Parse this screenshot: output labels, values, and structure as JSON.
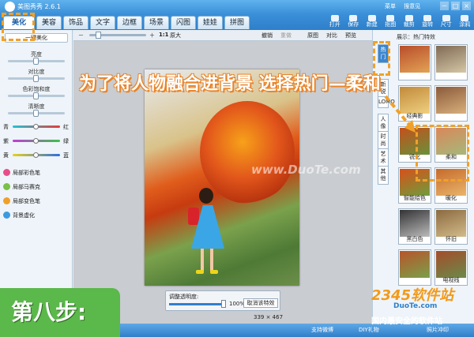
{
  "app": {
    "title": "美图秀秀 2.6.1",
    "window_links": [
      "菜单",
      "搜意见"
    ],
    "controls": [
      "－",
      "□",
      "×"
    ]
  },
  "tabs": [
    {
      "label": "美化",
      "active": true
    },
    {
      "label": "美容",
      "active": false
    },
    {
      "label": "饰品",
      "active": false
    },
    {
      "label": "文字",
      "active": false
    },
    {
      "label": "边框",
      "active": false
    },
    {
      "label": "场景",
      "active": false
    },
    {
      "label": "闪图",
      "active": false
    },
    {
      "label": "娃娃",
      "active": false
    },
    {
      "label": "拼图",
      "active": false
    }
  ],
  "toolbar": [
    "打开",
    "保存",
    "保存",
    "新建",
    "抠图",
    "裁剪",
    "旋转",
    "尺寸",
    "涂鸦",
    "撤销"
  ],
  "left_panel": {
    "one_click": "一键美化",
    "sliders": [
      {
        "label": "亮度",
        "value": 0.5
      },
      {
        "label": "对比度",
        "value": 0.5
      },
      {
        "label": "色彩饱和度",
        "value": 0.5
      },
      {
        "label": "清晰度",
        "value": 0.5
      }
    ],
    "color_sliders": [
      {
        "left": "青",
        "right": "红",
        "value": 0.5
      },
      {
        "left": "紫",
        "right": "绿",
        "value": 0.5
      },
      {
        "left": "黄",
        "right": "蓝",
        "value": 0.5
      }
    ],
    "brushes": [
      "局部彩色笔",
      "局部马赛克",
      "局部变色笔",
      "背景虚化"
    ]
  },
  "canvas_bar": {
    "zoom_ratio": "1:1",
    "zoom_original": "原大",
    "undo": "撤销",
    "redo": "重做",
    "original": "原图",
    "compare": "对比",
    "preview": "预览"
  },
  "photo": {
    "watermark": "www.DuoTe.com"
  },
  "opacity_panel": {
    "label": "调整透明度:",
    "value": "100%",
    "cancel": "取消该特效"
  },
  "image_dims": "339 × 467",
  "right_panel": {
    "header": "展示：热门特效",
    "vtabs": [
      "热门",
      "新锐",
      "LOMO",
      "人像",
      "时尚",
      "艺术",
      "其他"
    ],
    "thumbs": [
      {
        "label": "",
        "colors": [
          "#b84d2c",
          "#e3a354"
        ]
      },
      {
        "label": "",
        "colors": [
          "#7f6a55",
          "#d5c7a5"
        ]
      },
      {
        "label": "经典影",
        "colors": [
          "#c08a3a",
          "#f0d081"
        ]
      },
      {
        "label": "",
        "colors": [
          "#8a5a3a",
          "#d9b07c"
        ]
      },
      {
        "label": "锐化",
        "colors": [
          "#c5501c",
          "#68913a"
        ]
      },
      {
        "label": "柔和",
        "colors": [
          "#d9875a",
          "#a6b87a"
        ]
      },
      {
        "label": "智能绘色",
        "colors": [
          "#d8501a",
          "#6f9d3b"
        ]
      },
      {
        "label": "暖化",
        "colors": [
          "#c66a2a",
          "#e9b56b"
        ]
      },
      {
        "label": "黑白色",
        "colors": [
          "#333333",
          "#bbbbbb"
        ]
      },
      {
        "label": "怀旧",
        "colors": [
          "#8a6a40",
          "#d3bb8a"
        ]
      },
      {
        "label": "",
        "colors": [
          "#b8542a",
          "#7aa04a"
        ]
      },
      {
        "label": "电视线",
        "colors": [
          "#a54c2a",
          "#6a8a4a"
        ]
      }
    ]
  },
  "statusbar": [
    "支持微博",
    "DIY礼物",
    "照片冲印"
  ],
  "annotation": {
    "caption": "为了将人物融合进背景 选择热门—柔和",
    "step": "第八步:"
  },
  "site": {
    "logo": "2345软件站",
    "url": "DuoTe.com",
    "slogan": "国内最安全的软件站"
  }
}
